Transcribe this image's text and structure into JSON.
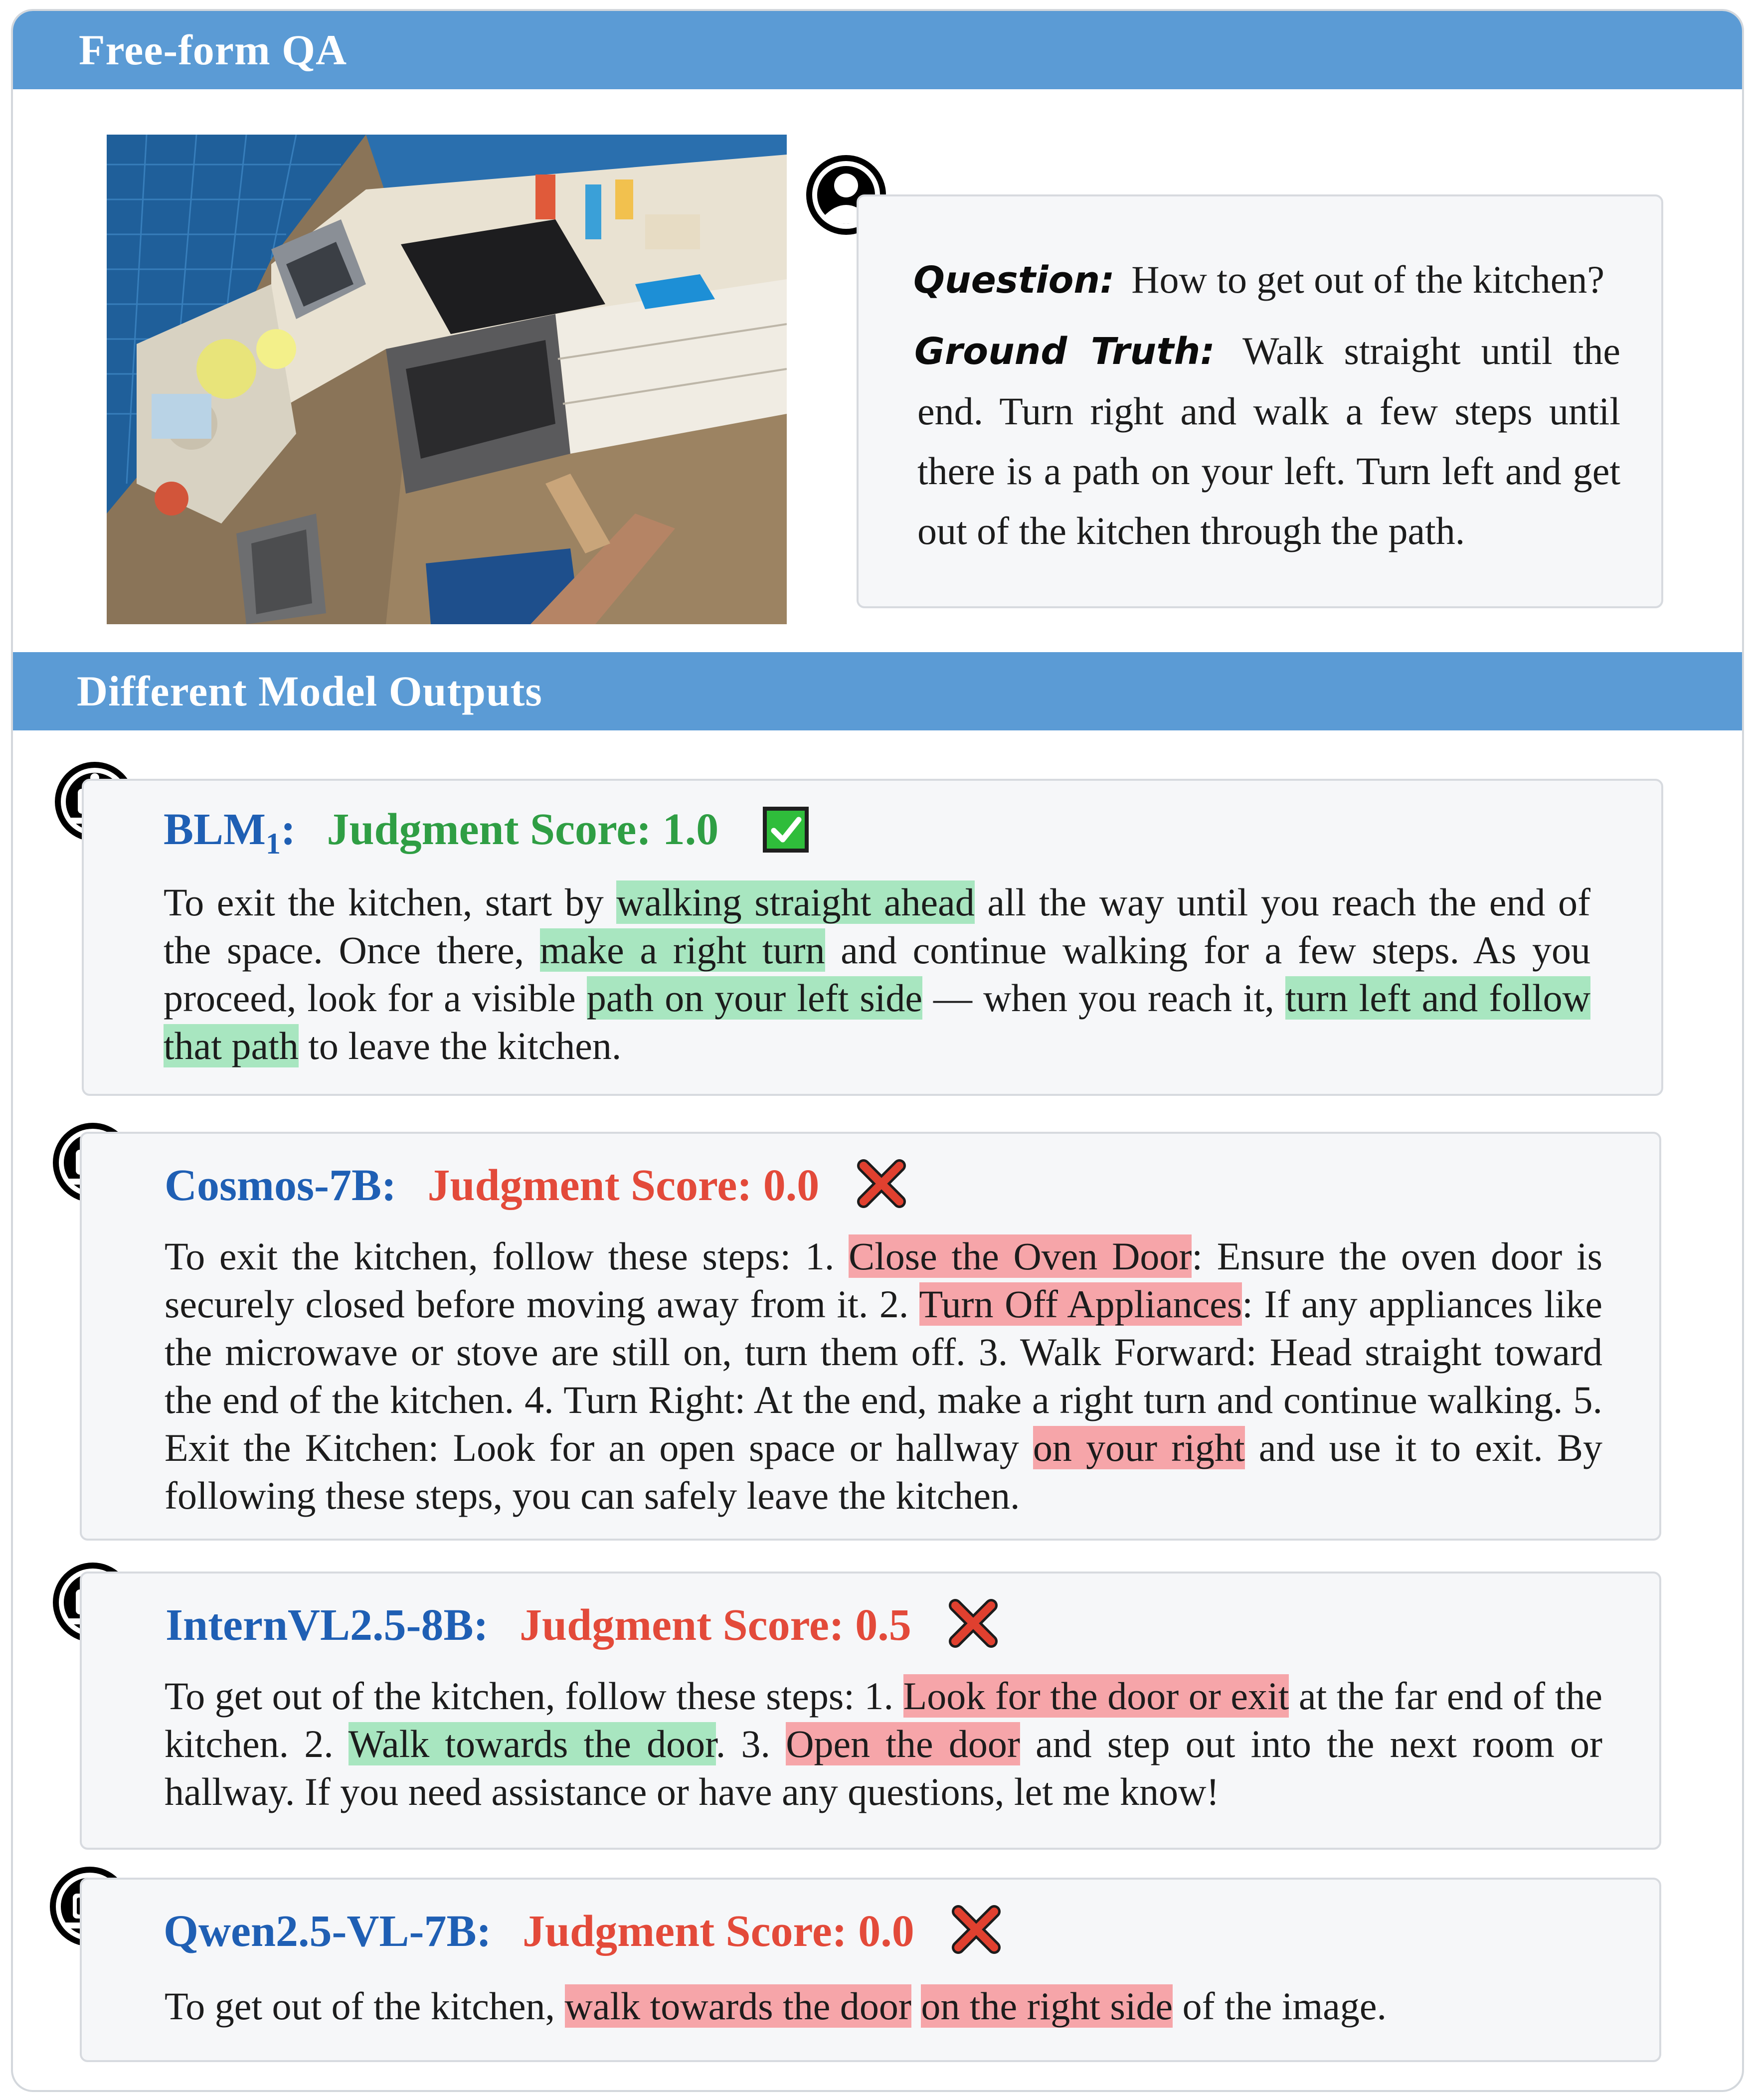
{
  "sections": {
    "qa_title": "Free-form QA",
    "outputs_title": "Different Model Outputs"
  },
  "qa": {
    "question_key": "Question",
    "question": "How to get out of the kitchen?",
    "gt_key": "Ground Truth",
    "ground_truth": "Walk straight until the end. Turn right and walk a few steps until there is a path on your left. Turn left and get out of the kitchen through the path."
  },
  "models": [
    {
      "name": "BLM",
      "name_sub": "1",
      "score_label": "Judgment Score: 1.0",
      "verdict_icon": "check-icon",
      "segments": [
        {
          "t": "To exit the kitchen, start by ",
          "h": ""
        },
        {
          "t": "walking straight ahead",
          "h": "g"
        },
        {
          "t": " all the way until you reach the end of the space. Once there, ",
          "h": ""
        },
        {
          "t": "make a right turn",
          "h": "g"
        },
        {
          "t": " and continue walking for a few steps. As you proceed, look for a visible ",
          "h": ""
        },
        {
          "t": "path on your left side",
          "h": "g"
        },
        {
          "t": " — when you reach it, ",
          "h": ""
        },
        {
          "t": "turn left and follow that path",
          "h": "g"
        },
        {
          "t": " to leave the kitchen.",
          "h": ""
        }
      ]
    },
    {
      "name": "Cosmos-7B",
      "name_sub": "",
      "score_label": "Judgment Score: 0.0",
      "verdict_icon": "cross-icon",
      "segments": [
        {
          "t": "To exit the kitchen, follow these steps: 1. ",
          "h": ""
        },
        {
          "t": "Close the Oven Door",
          "h": "r"
        },
        {
          "t": ": Ensure the oven door is securely closed before moving away from it. 2. ",
          "h": ""
        },
        {
          "t": "Turn Off Appliances",
          "h": "r"
        },
        {
          "t": ": If any appliances like the microwave or stove are still on, turn them off. 3. Walk Forward: Head straight toward the end of the kitchen. 4. Turn Right: At the end, make a right turn and continue walking. 5. Exit the Kitchen: Look for an open space or hallway ",
          "h": ""
        },
        {
          "t": "on your right",
          "h": "r"
        },
        {
          "t": " and use it to exit. By following these steps, you can safely leave the kitchen.",
          "h": ""
        }
      ]
    },
    {
      "name": "InternVL2.5-8B",
      "name_sub": "",
      "score_label": "Judgment Score: 0.5",
      "verdict_icon": "cross-icon",
      "segments": [
        {
          "t": "To get out of the kitchen, follow these steps: 1. ",
          "h": ""
        },
        {
          "t": "Look for the door or exit",
          "h": "r"
        },
        {
          "t": " at the far end of the kitchen. 2. ",
          "h": ""
        },
        {
          "t": "Walk towards the door",
          "h": "g"
        },
        {
          "t": ". 3. ",
          "h": ""
        },
        {
          "t": "Open the door",
          "h": "r"
        },
        {
          "t": " and step out into the next room or hallway. If you need assistance or have any questions, let me know!",
          "h": ""
        }
      ]
    },
    {
      "name": "Qwen2.5-VL-7B",
      "name_sub": "",
      "score_label": "Judgment Score: 0.0",
      "verdict_icon": "cross-icon",
      "segments": [
        {
          "t": "To get out of the kitchen, ",
          "h": ""
        },
        {
          "t": "walk towards the door",
          "h": "r"
        },
        {
          "t": " ",
          "h": ""
        },
        {
          "t": "on the right side",
          "h": "r"
        },
        {
          "t": " of the image.",
          "h": ""
        }
      ]
    }
  ],
  "colors": {
    "section_bar": "#5b9bd5",
    "model_name": "#1f5fb4",
    "score_good": "#2f9e44",
    "score_bad": "#e34a3a",
    "highlight_correct": "#a8e6c0",
    "highlight_wrong": "#f6a5a9"
  }
}
